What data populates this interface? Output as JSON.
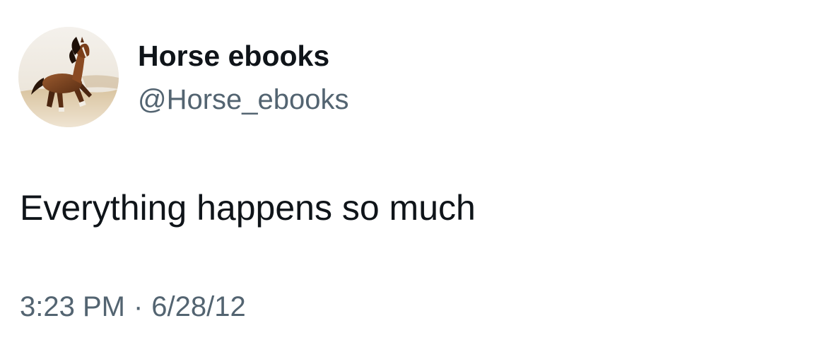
{
  "author": {
    "display_name": "Horse ebooks",
    "handle": "@Horse_ebooks",
    "avatar_icon": "horse-photo-avatar"
  },
  "tweet": {
    "text": "Everything happens so much"
  },
  "meta": {
    "time": "3:23 PM",
    "separator": "·",
    "date": "6/28/12"
  },
  "colors": {
    "primary_text": "#0f1419",
    "secondary_text": "#536471",
    "background": "#ffffff"
  }
}
